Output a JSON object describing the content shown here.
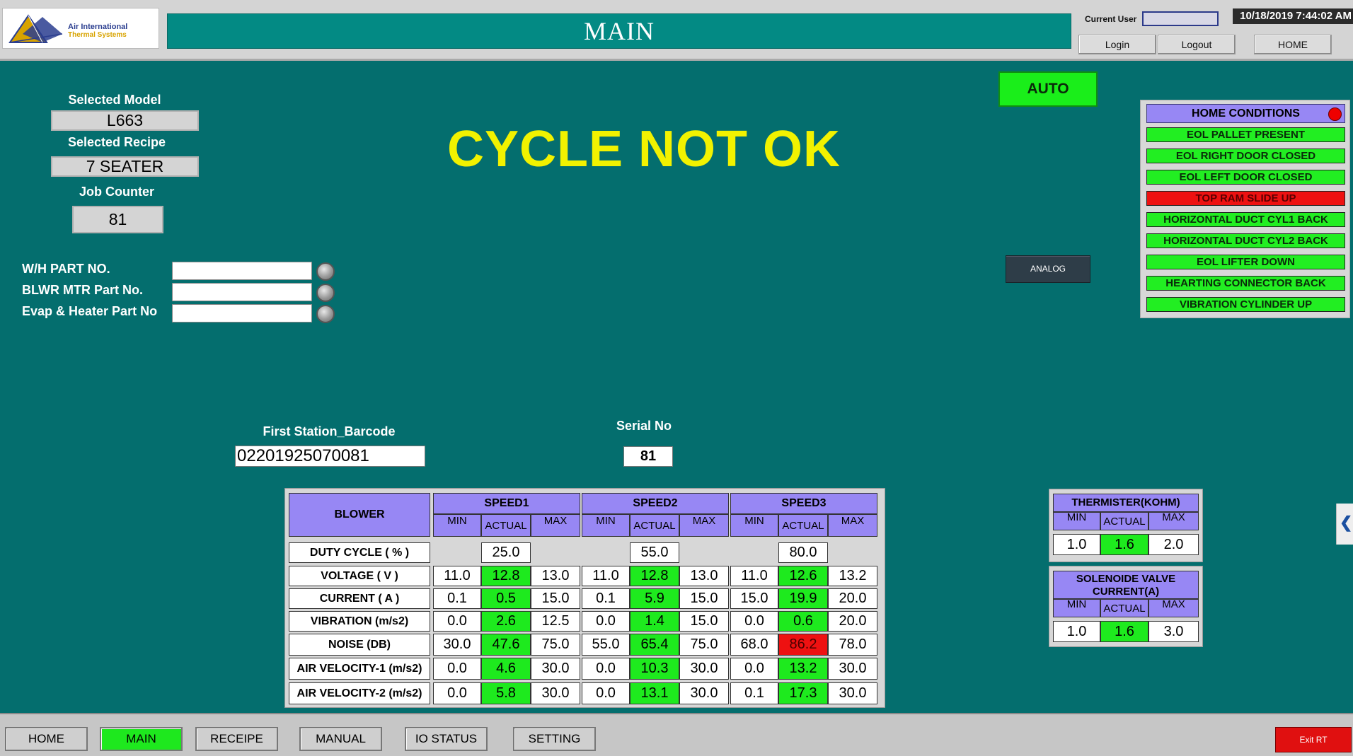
{
  "header": {
    "logo_line1": "Air International",
    "logo_line2": "Thermal Systems",
    "title": "MAIN",
    "current_user_label": "Current User",
    "current_user_value": "",
    "datetime": "10/18/2019 7:44:02 AM",
    "login": "Login",
    "logout": "Logout",
    "home": "HOME"
  },
  "info": {
    "selected_model_label": "Selected Model",
    "selected_model": "L663",
    "selected_recipe_label": "Selected Recipe",
    "selected_recipe": "7 SEATER",
    "job_counter_label": "Job Counter",
    "job_counter": "81"
  },
  "parts": {
    "wh_label": "W/H PART NO.",
    "wh_value": "",
    "blwr_label": "BLWR MTR Part  No.",
    "blwr_value": "",
    "evap_label": "Evap & Heater Part  No",
    "evap_value": ""
  },
  "status": {
    "cycle": "CYCLE NOT OK",
    "mode": "AUTO",
    "analog": "ANALOG"
  },
  "home_conditions": {
    "title": "HOME CONDITIONS",
    "items": [
      {
        "label": "EOL PALLET PRESENT",
        "ok": true
      },
      {
        "label": "EOL RIGHT DOOR CLOSED",
        "ok": true
      },
      {
        "label": "EOL LEFT DOOR CLOSED",
        "ok": true
      },
      {
        "label": "TOP RAM SLIDE UP",
        "ok": false
      },
      {
        "label": "HORIZONTAL DUCT CYL1 BACK",
        "ok": true
      },
      {
        "label": "HORIZONTAL DUCT CYL2 BACK",
        "ok": true
      },
      {
        "label": "EOL LIFTER DOWN",
        "ok": true
      },
      {
        "label": "HEARTING CONNECTOR BACK",
        "ok": true
      },
      {
        "label": "VIBRATION CYLINDER UP",
        "ok": true
      }
    ]
  },
  "barcode": {
    "label": "First Station_Barcode",
    "value": "02201925070081",
    "serial_label": "Serial No",
    "serial_value": "81"
  },
  "blower": {
    "title": "BLOWER",
    "speeds": [
      "SPEED1",
      "SPEED2",
      "SPEED3"
    ],
    "sub_headers": [
      "MIN",
      "ACTUAL",
      "MAX"
    ],
    "duty_label": "DUTY CYCLE ( % )",
    "duty": [
      "25.0",
      "55.0",
      "80.0"
    ],
    "rows": [
      {
        "label": "VOLTAGE ( V )",
        "values": [
          "11.0",
          "12.8",
          "13.0",
          "11.0",
          "12.8",
          "13.0",
          "11.0",
          "12.6",
          "13.2"
        ],
        "status": [
          "ok",
          "ok",
          "ok"
        ]
      },
      {
        "label": "CURRENT ( A )",
        "values": [
          "0.1",
          "0.5",
          "15.0",
          "0.1",
          "5.9",
          "15.0",
          "15.0",
          "19.9",
          "20.0"
        ],
        "status": [
          "ok",
          "ok",
          "ok"
        ]
      },
      {
        "label": "VIBRATION (m/s2)",
        "values": [
          "0.0",
          "2.6",
          "12.5",
          "0.0",
          "1.4",
          "15.0",
          "0.0",
          "0.6",
          "20.0"
        ],
        "status": [
          "ok",
          "ok",
          "ok"
        ]
      },
      {
        "label": "NOISE (DB)",
        "values": [
          "30.0",
          "47.6",
          "75.0",
          "55.0",
          "65.4",
          "75.0",
          "68.0",
          "86.2",
          "78.0"
        ],
        "status": [
          "ok",
          "ok",
          "fail"
        ]
      },
      {
        "label": "AIR VELOCITY-1 (m/s2)",
        "values": [
          "0.0",
          "4.6",
          "30.0",
          "0.0",
          "10.3",
          "30.0",
          "0.0",
          "13.2",
          "30.0"
        ],
        "status": [
          "ok",
          "ok",
          "ok"
        ]
      },
      {
        "label": "AIR VELOCITY-2 (m/s2)",
        "values": [
          "0.0",
          "5.8",
          "30.0",
          "0.0",
          "13.1",
          "30.0",
          "0.1",
          "17.3",
          "30.0"
        ],
        "status": [
          "ok",
          "ok",
          "ok"
        ]
      }
    ]
  },
  "thermister": {
    "title": "THERMISTER(KOHM)",
    "sub_headers": [
      "MIN",
      "ACTUAL",
      "MAX"
    ],
    "values": [
      "1.0",
      "1.6",
      "2.0"
    ]
  },
  "solenoid": {
    "title_line1": "SOLENOIDE VALVE",
    "title_line2": "CURRENT(A)",
    "sub_headers": [
      "MIN",
      "ACTUAL",
      "MAX"
    ],
    "values": [
      "1.0",
      "1.6",
      "3.0"
    ]
  },
  "nav": {
    "home": "HOME",
    "main": "MAIN",
    "receipe": "RECEIPE",
    "manual": "MANUAL",
    "io_status": "IO STATUS",
    "setting": "SETTING",
    "exit": "Exit RT",
    "side_tab": "❮"
  },
  "colors": {
    "background": "#046e6e",
    "header_title": "#038a84",
    "ok": "#1eea1e",
    "fail": "#ee1111",
    "table_header": "#9787f4",
    "cycle_text": "#f2f200"
  }
}
